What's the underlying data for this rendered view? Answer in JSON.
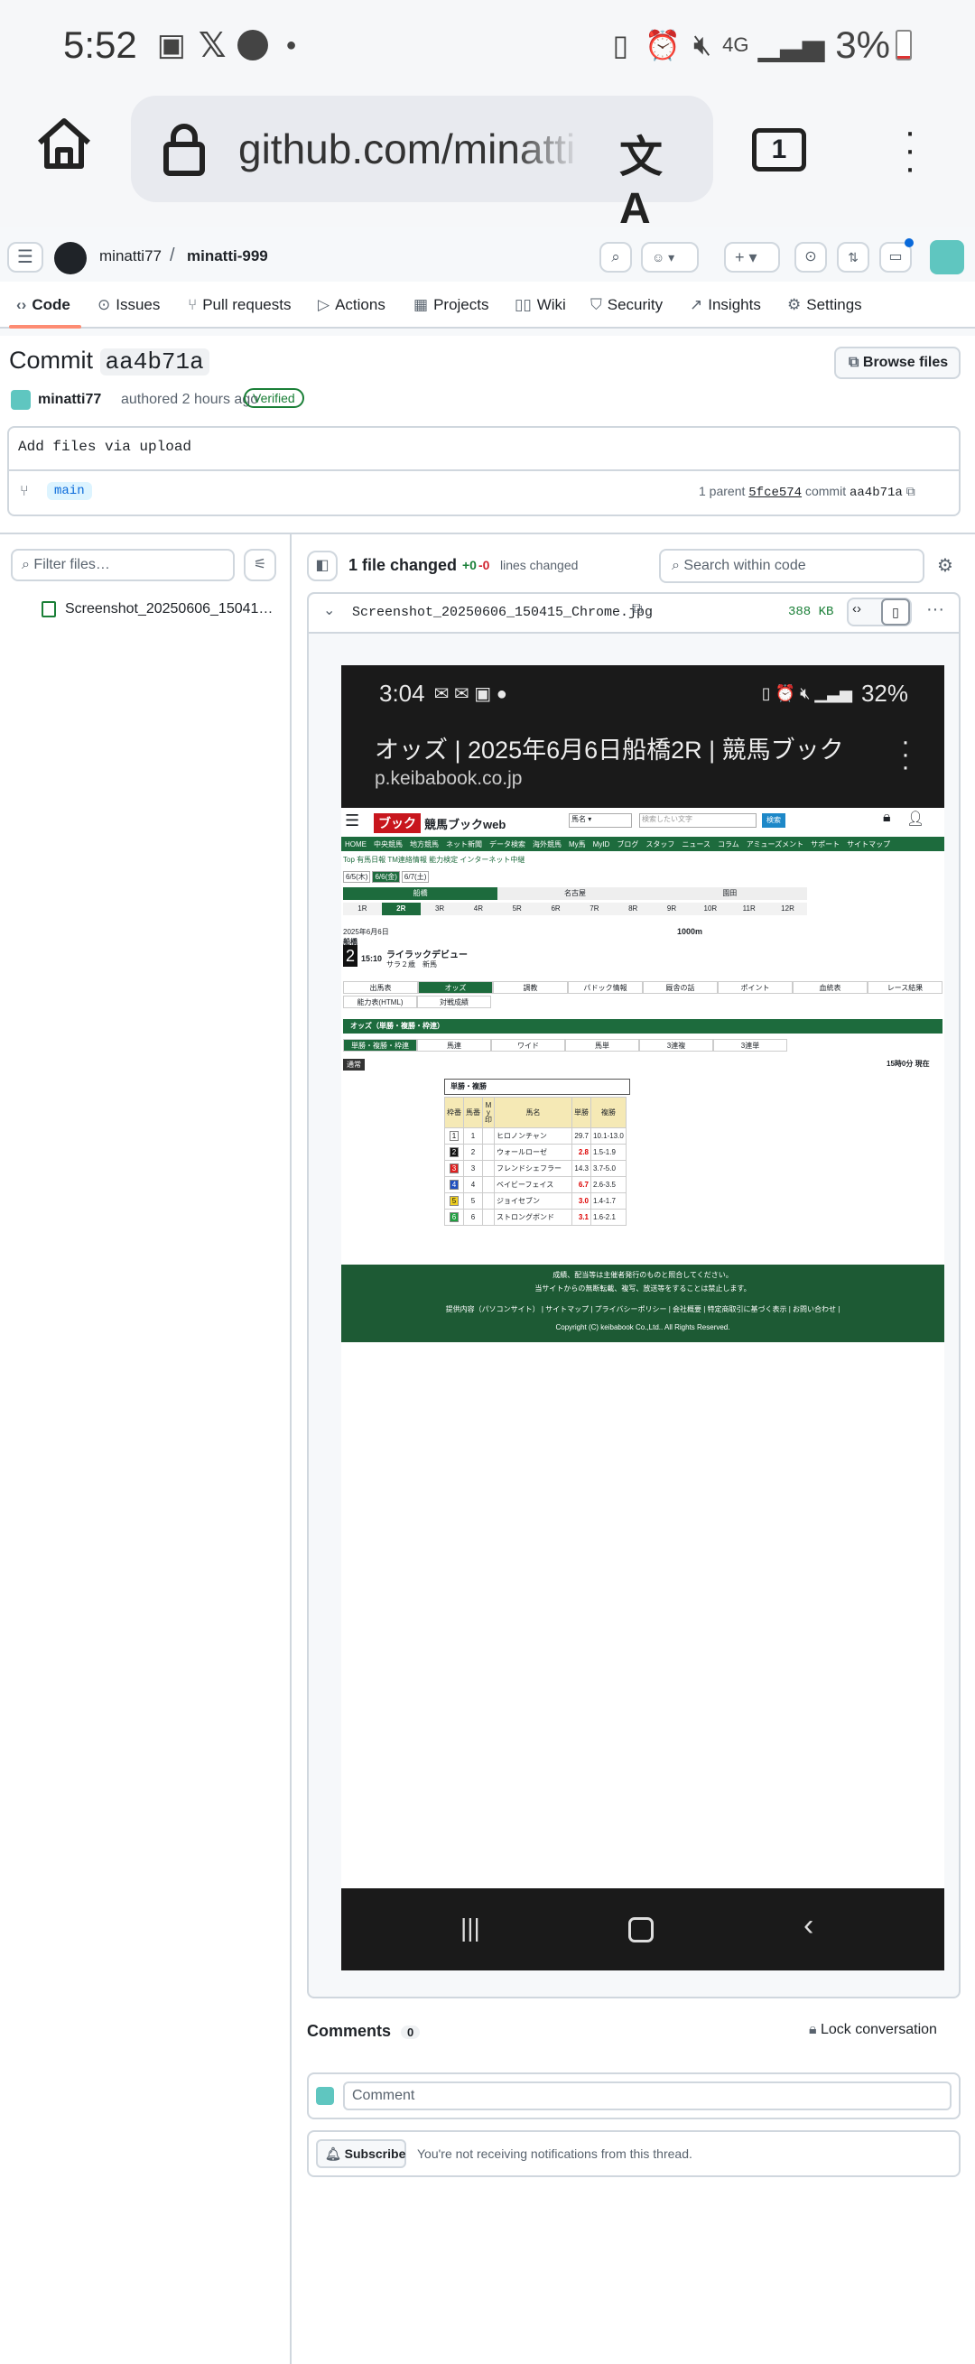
{
  "statusbar": {
    "time": "5:52",
    "battery": "3%",
    "network": "4G"
  },
  "browser": {
    "url": "github.com/minatti",
    "tabs_count": "1"
  },
  "repo": {
    "owner": "minatti77",
    "separator": "/",
    "name": "minatti-999"
  },
  "tabs": [
    {
      "label": "Code",
      "icon": "code-icon"
    },
    {
      "label": "Issues",
      "icon": "issue-icon"
    },
    {
      "label": "Pull requests",
      "icon": "pull-request-icon"
    },
    {
      "label": "Actions",
      "icon": "play-icon"
    },
    {
      "label": "Projects",
      "icon": "table-icon"
    },
    {
      "label": "Wiki",
      "icon": "book-icon"
    },
    {
      "label": "Security",
      "icon": "shield-icon"
    },
    {
      "label": "Insights",
      "icon": "graph-icon"
    },
    {
      "label": "Settings",
      "icon": "gear-icon"
    }
  ],
  "commit": {
    "title_prefix": "Commit",
    "sha": "aa4b71a",
    "browse_files": "Browse files",
    "author": "minatti77",
    "authored": "authored 2 hours ago",
    "verified": "Verified",
    "message": "Add files via upload",
    "branch": "main",
    "parent_label": "1 parent",
    "parent_sha": "5fce574",
    "commit_label": "commit",
    "commit_sha": "aa4b71a"
  },
  "files": {
    "filter_placeholder": "Filter files…",
    "tree_file": "Screenshot_20250606_15041…",
    "changed_label": "1 file changed",
    "additions": "+0",
    "deletions": "-0",
    "lines_changed": "lines changed",
    "search_placeholder": "Search within code",
    "file_name": "Screenshot_20250606_150415_Chrome.jpg",
    "file_size": "388 KB"
  },
  "inner": {
    "time": "3:04",
    "battery": "32%",
    "page_title": "オッズ | 2025年6月6日船橋2R | 競馬ブック",
    "page_url": "p.keibabook.co.jp",
    "logo": "競馬ブックweb",
    "nav": [
      "HOME",
      "中央競馬",
      "地方競馬",
      "ネット新聞",
      "データ検索",
      "海外競馬",
      "My馬",
      "MyID",
      "ブログ",
      "スタッフ",
      "ニュース",
      "コラム",
      "アミューズメント",
      "サポート",
      "サイトマップ"
    ],
    "subnav": "Top 有馬日報 TM連絡情報 能力検定 インターネット中継",
    "dates": [
      "6/5(木)",
      "6/6(金)",
      "6/7(土)"
    ],
    "venues": [
      "船橋",
      "名古屋",
      "園田"
    ],
    "races": [
      "1R",
      "2R",
      "3R",
      "4R",
      "5R",
      "6R",
      "7R",
      "8R",
      "9R",
      "10R",
      "11R",
      "12R"
    ],
    "race_date": "2025年6月6日",
    "race_place": "船橋",
    "race_no": "2",
    "race_time": "15:10",
    "race_name": "ライラックデビュー",
    "race_class": "サラ２歳　新馬",
    "race_dist": "1000m",
    "subtabs": [
      "出馬表",
      "オッズ",
      "調教",
      "パドック情報",
      "厩舎の話",
      "ポイント",
      "血統表",
      "レース結果"
    ],
    "subtabs2": [
      "能力表(HTML)",
      "対戦成績"
    ],
    "odds_heading": "オッズ（単勝・複勝・枠連）",
    "odds_tabs": [
      "単勝・複勝・枠連",
      "馬連",
      "ワイド",
      "馬単",
      "3連複",
      "3連単"
    ],
    "normal": "通常",
    "updated": "15時0分 現在",
    "table_title": "単勝・複勝",
    "headers": [
      "枠番",
      "馬番",
      "M y 印",
      "馬名",
      "単勝",
      "複勝"
    ],
    "rows": [
      {
        "waku": "1",
        "num": "1",
        "name": "ヒロノンチャン",
        "win": "29.7",
        "place": "10.1-13.0",
        "color": "#ffffff",
        "hot": false
      },
      {
        "waku": "2",
        "num": "2",
        "name": "ウォールローゼ",
        "win": "2.8",
        "place": "1.5-1.9",
        "color": "#111111",
        "hot": true
      },
      {
        "waku": "3",
        "num": "3",
        "name": "フレンドシェフラー",
        "win": "14.3",
        "place": "3.7-5.0",
        "color": "#e02020",
        "hot": false
      },
      {
        "waku": "4",
        "num": "4",
        "name": "ベイビーフェイス",
        "win": "6.7",
        "place": "2.6-3.5",
        "color": "#2050c0",
        "hot": true
      },
      {
        "waku": "5",
        "num": "5",
        "name": "ジョイセブン",
        "win": "3.0",
        "place": "1.4-1.7",
        "color": "#f0d020",
        "hot": true
      },
      {
        "waku": "6",
        "num": "6",
        "name": "ストロングボンド",
        "win": "3.1",
        "place": "1.6-2.1",
        "color": "#20a040",
        "hot": true
      }
    ],
    "footer1": "成績、配当等は主催者発行のものと照合してください。",
    "footer2": "当サイトからの無断転載、複写、放送等をすることは禁止します。",
    "footer3": "提供内容（パソコンサイト） | サイトマップ | プライバシーポリシー | 会社概要 | 特定商取引に基づく表示 | お問い合わせ |",
    "copyright": "Copyright (C) keibabook Co.,Ltd.. All Rights Reserved."
  },
  "comments": {
    "title": "Comments",
    "count": "0",
    "lock": "Lock conversation",
    "placeholder": "Comment",
    "subscribe": "Subscribe",
    "notice": "You're not receiving notifications from this thread."
  }
}
